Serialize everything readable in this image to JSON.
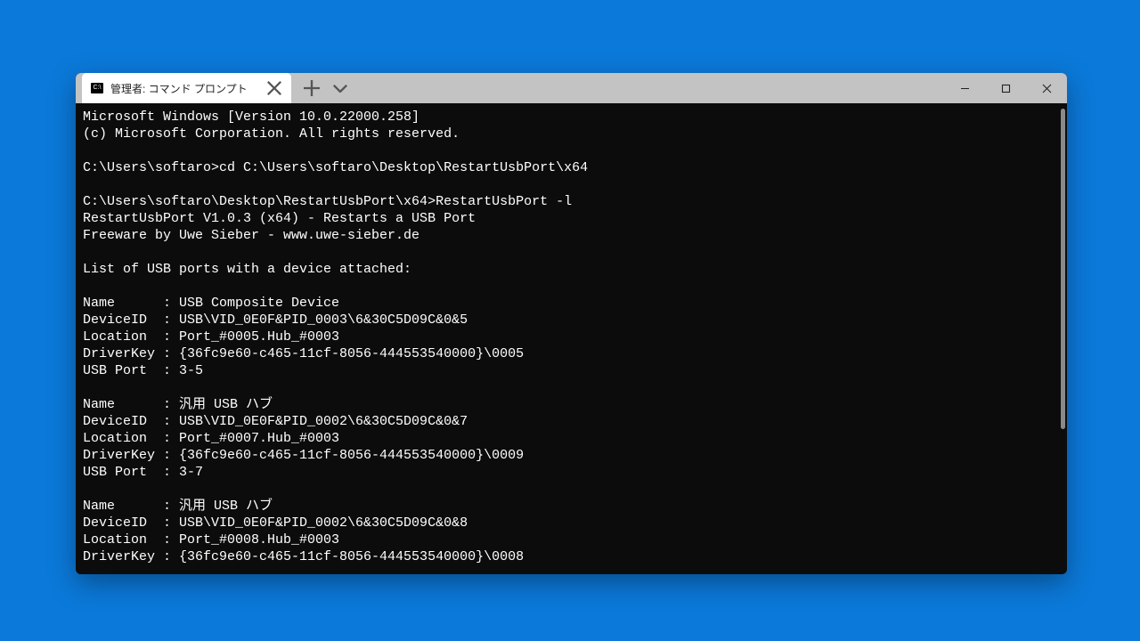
{
  "tab": {
    "title": "管理者: コマンド プロンプト"
  },
  "controls": {
    "new_tab": "+",
    "dropdown": "⌄"
  },
  "terminal": {
    "lines": [
      "Microsoft Windows [Version 10.0.22000.258]",
      "(c) Microsoft Corporation. All rights reserved.",
      "",
      "C:\\Users\\softaro>cd C:\\Users\\softaro\\Desktop\\RestartUsbPort\\x64",
      "",
      "C:\\Users\\softaro\\Desktop\\RestartUsbPort\\x64>RestartUsbPort -l",
      "RestartUsbPort V1.0.3 (x64) - Restarts a USB Port",
      "Freeware by Uwe Sieber - www.uwe-sieber.de",
      "",
      "List of USB ports with a device attached:",
      "",
      "Name      : USB Composite Device",
      "DeviceID  : USB\\VID_0E0F&PID_0003\\6&30C5D09C&0&5",
      "Location  : Port_#0005.Hub_#0003",
      "DriverKey : {36fc9e60-c465-11cf-8056-444553540000}\\0005",
      "USB Port  : 3-5",
      "",
      "Name      : 汎用 USB ハブ",
      "DeviceID  : USB\\VID_0E0F&PID_0002\\6&30C5D09C&0&7",
      "Location  : Port_#0007.Hub_#0003",
      "DriverKey : {36fc9e60-c465-11cf-8056-444553540000}\\0009",
      "USB Port  : 3-7",
      "",
      "Name      : 汎用 USB ハブ",
      "DeviceID  : USB\\VID_0E0F&PID_0002\\6&30C5D09C&0&8",
      "Location  : Port_#0008.Hub_#0003",
      "DriverKey : {36fc9e60-c465-11cf-8056-444553540000}\\0008"
    ]
  }
}
